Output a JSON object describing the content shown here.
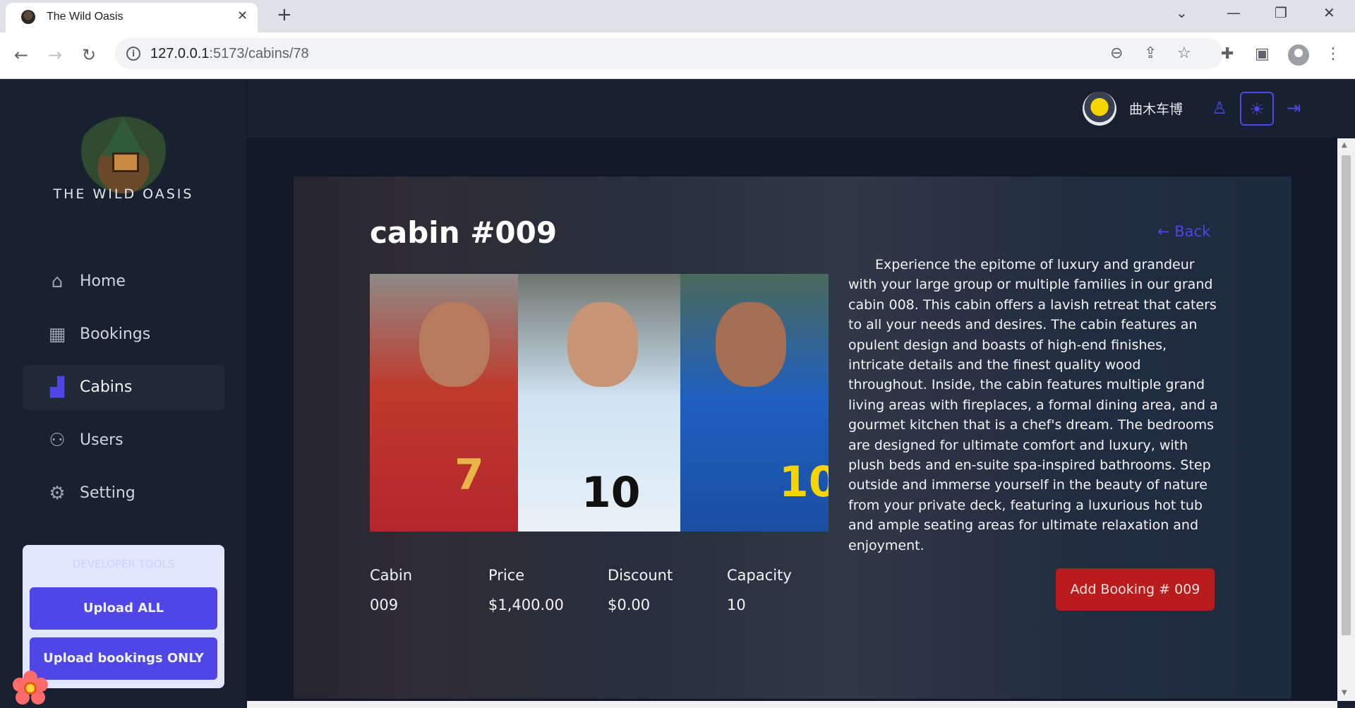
{
  "browser": {
    "tab_title": "The Wild Oasis",
    "tab_close": "✕",
    "new_tab": "+",
    "url_host": "127.0.0.1",
    "url_rest": ":5173/cabins/78",
    "window_controls": {
      "dropdown": "⌄",
      "minimize": "—",
      "restore": "❐",
      "close": "✕"
    }
  },
  "sidebar": {
    "logo_text": "THE WILD OASIS",
    "items": [
      {
        "label": "Home",
        "icon": "home-icon",
        "active": false
      },
      {
        "label": "Bookings",
        "icon": "calendar-icon",
        "active": false
      },
      {
        "label": "Cabins",
        "icon": "building-icon",
        "active": true
      },
      {
        "label": "Users",
        "icon": "users-icon",
        "active": false
      },
      {
        "label": "Setting",
        "icon": "gear-icon",
        "active": false
      }
    ],
    "upload_panel": {
      "label": "DEVELOPER TOOLS",
      "upload_all": "Upload ALL",
      "upload_bookings": "Upload bookings ONLY"
    }
  },
  "header": {
    "username": "曲木车博"
  },
  "cabin": {
    "title": "cabin #009",
    "back_label": "← Back",
    "description": "Experience the epitome of luxury and grandeur with your large group or multiple families in our grand cabin 008. This cabin offers a lavish retreat that caters to all your needs and desires. The cabin features an opulent design and boasts of high-end finishes, intricate details and the finest quality wood throughout. Inside, the cabin features multiple grand living areas with fireplaces, a formal dining area, and a gourmet kitchen that is a chef's dream. The bedrooms are designed for ultimate comfort and luxury, with plush beds and en-suite spa-inspired bathrooms. Step outside and immerse yourself in the beauty of nature from your private deck, featuring a luxurious hot tub and ample seating areas for ultimate relaxation and enjoyment.",
    "stats": [
      {
        "label": "Cabin",
        "value": "009"
      },
      {
        "label": "Price",
        "value": "$1,400.00"
      },
      {
        "label": "Discount",
        "value": "$0.00"
      },
      {
        "label": "Capacity",
        "value": "10"
      }
    ],
    "add_booking_label": "Add Booking # 009",
    "image_jersey_numbers": [
      "7",
      "10",
      "10"
    ]
  },
  "colors": {
    "accent": "#4f46e5",
    "danger": "#b91c1c",
    "sidebar_bg": "#18212f",
    "main_bg": "#111827"
  }
}
